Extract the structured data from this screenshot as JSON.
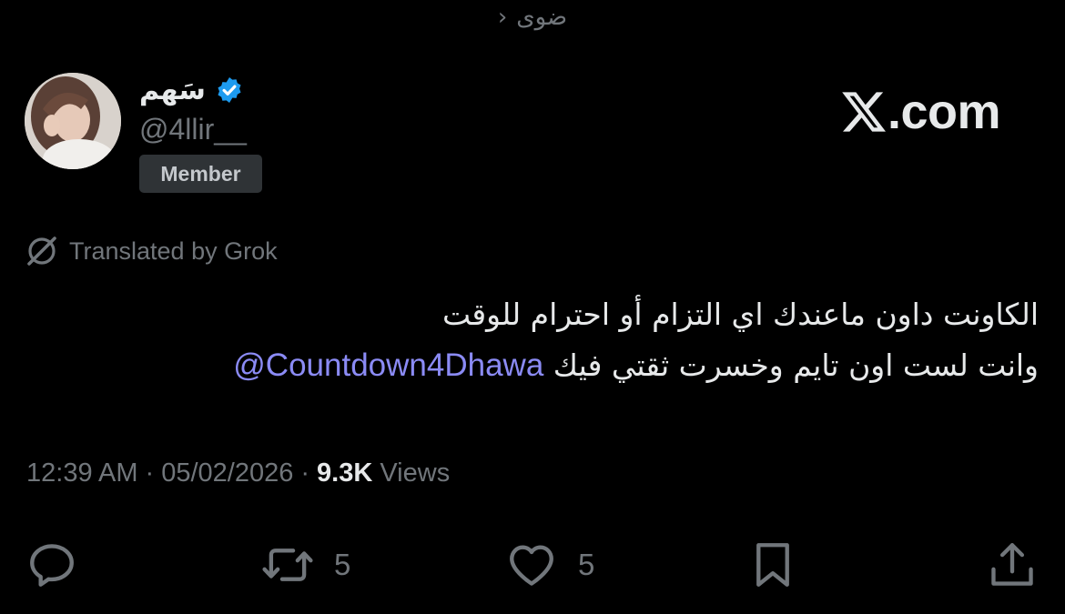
{
  "community": {
    "name": "ضوى",
    "chevron": "›"
  },
  "author": {
    "display_name": "سَهم",
    "handle": "@4llir__",
    "badge": "Member",
    "verified_icon": "verified-badge-icon",
    "avatar": "user-avatar"
  },
  "brand": {
    "logo_text": ".com"
  },
  "translation": {
    "label": "Translated by Grok",
    "icon": "grok-icon"
  },
  "tweet": {
    "line1": "الكاونت داون ماعندك اي التزام أو احترام للوقت",
    "line2": "وانت لست اون تايم وخسرت ثقتي فيك",
    "mention": "@Countdown4Dhawa"
  },
  "meta": {
    "time": "12:39 AM",
    "separator1": "·",
    "date": "05/02/2026",
    "separator2": "·",
    "views_count": "9.3K",
    "views_label": "Views"
  },
  "actions": {
    "reply": {
      "icon": "reply-icon"
    },
    "repost": {
      "icon": "repost-icon",
      "count": "5"
    },
    "like": {
      "icon": "heart-icon",
      "count": "5"
    },
    "bookmark": {
      "icon": "bookmark-icon"
    },
    "share": {
      "icon": "share-icon"
    }
  },
  "colors": {
    "background": "#000000",
    "text": "#e7e9ea",
    "secondary": "#71767b",
    "mention": "#8b8bf5",
    "verified": "#1d9bf0",
    "badge_bg": "#2f3336"
  }
}
